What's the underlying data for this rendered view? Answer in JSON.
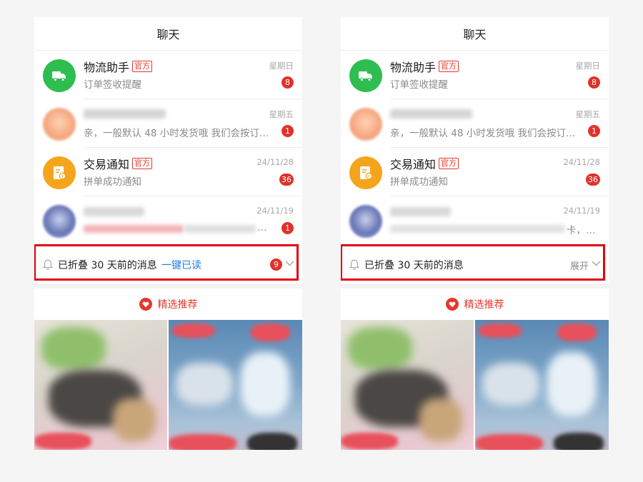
{
  "panels": [
    {
      "header_title": "聊天",
      "chats": [
        {
          "title": "物流助手",
          "tag": "官方",
          "preview": "订单签收提醒",
          "time": "星期日",
          "unread": "8",
          "avatar_icon": "truck-icon"
        },
        {
          "title": "",
          "tag": "",
          "preview": "亲，一般默认 48 小时发货哦 我们会按订…",
          "time": "星期五",
          "unread": "1",
          "avatar_icon": "blurred-avatar"
        },
        {
          "title": "交易通知",
          "tag": "官方",
          "preview": "拼单成功通知",
          "time": "24/11/28",
          "unread": "36",
          "avatar_icon": "receipt-icon"
        },
        {
          "title": "",
          "tag": "",
          "preview": "…",
          "time": "24/11/19",
          "unread": "1",
          "avatar_icon": "blurred-avatar"
        }
      ],
      "fold": {
        "text": "已折叠 30 天前的消息",
        "action": "一键已读",
        "badge": "9"
      },
      "recommend_label": "精选推荐"
    },
    {
      "header_title": "聊天",
      "chats": [
        {
          "title": "物流助手",
          "tag": "官方",
          "preview": "订单签收提醒",
          "time": "星期日",
          "unread": "8",
          "avatar_icon": "truck-icon"
        },
        {
          "title": "",
          "tag": "",
          "preview": "亲，一般默认 48 小时发货哦 我们会按订…",
          "time": "星期五",
          "unread": "1",
          "avatar_icon": "blurred-avatar"
        },
        {
          "title": "交易通知",
          "tag": "官方",
          "preview": "拼单成功通知",
          "time": "24/11/28",
          "unread": "36",
          "avatar_icon": "receipt-icon"
        },
        {
          "title": "",
          "tag": "",
          "preview": "卡，…",
          "time": "24/11/19",
          "unread": "",
          "avatar_icon": "blurred-avatar"
        }
      ],
      "fold": {
        "text": "已折叠 30 天前的消息",
        "action": "展开",
        "badge": ""
      },
      "recommend_label": "精选推荐"
    }
  ],
  "colors": {
    "accent_red": "#e3392c",
    "badge_red": "#e0322a",
    "link_blue": "#1d7ce0",
    "highlight_red": "#e3000e"
  }
}
